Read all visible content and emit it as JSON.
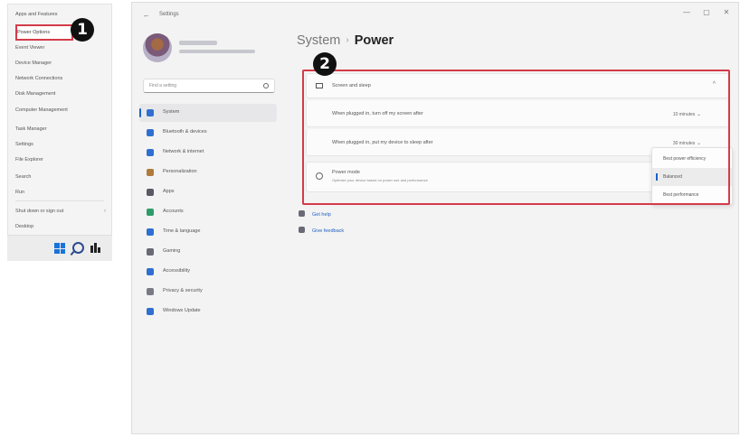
{
  "winx_menu": {
    "items": [
      "Apps and Features",
      "Power Options",
      "Event Viewer",
      "Device Manager",
      "Network Connections",
      "Disk Management",
      "Computer Management",
      "Task Manager",
      "Settings",
      "File Explorer",
      "Search",
      "Run",
      "Shut down or sign out",
      "Desktop"
    ],
    "highlighted_item": "Power Options",
    "submenu_arrow": "›"
  },
  "callouts": {
    "step1": "1",
    "step2": "2"
  },
  "settings": {
    "window_title": "Settings",
    "back_glyph": "←",
    "window_controls": {
      "minimize": "—",
      "maximize": "▢",
      "close": "✕"
    },
    "search_placeholder": "Find a setting",
    "breadcrumb": {
      "parent": "System",
      "separator": "›",
      "current": "Power"
    },
    "nav": [
      {
        "label": "System",
        "icon": "monitor-icon",
        "color": "#2f6fd0"
      },
      {
        "label": "Bluetooth & devices",
        "icon": "bluetooth-icon",
        "color": "#2f6fd0"
      },
      {
        "label": "Network & internet",
        "icon": "wifi-icon",
        "color": "#2f6fd0"
      },
      {
        "label": "Personalization",
        "icon": "brush-icon",
        "color": "#b07a3a"
      },
      {
        "label": "Apps",
        "icon": "apps-icon",
        "color": "#5a5a66"
      },
      {
        "label": "Accounts",
        "icon": "person-icon",
        "color": "#2e9c6a"
      },
      {
        "label": "Time & language",
        "icon": "globe-clock-icon",
        "color": "#2f6fd0"
      },
      {
        "label": "Gaming",
        "icon": "gamepad-icon",
        "color": "#6a6a74"
      },
      {
        "label": "Accessibility",
        "icon": "accessibility-icon",
        "color": "#2f6fd0"
      },
      {
        "label": "Privacy & security",
        "icon": "shield-icon",
        "color": "#7a7a84"
      },
      {
        "label": "Windows Update",
        "icon": "update-icon",
        "color": "#2f6fd0"
      }
    ],
    "screen_sleep": {
      "title": "Screen and sleep",
      "row1_label": "When plugged in, turn off my screen after",
      "row1_value": "10 minutes",
      "row2_label": "When plugged in, put my device to sleep after",
      "row2_value": "30 minutes"
    },
    "power_mode": {
      "title": "Power mode",
      "description": "Optimize your device based on power use and performance",
      "options": [
        "Best power efficiency",
        "Balanced",
        "Best performance"
      ],
      "selected": "Balanced"
    },
    "links": [
      "Get help",
      "Give feedback"
    ]
  },
  "colors": {
    "highlight": "#d43b4a",
    "accent": "#1a63c8"
  }
}
